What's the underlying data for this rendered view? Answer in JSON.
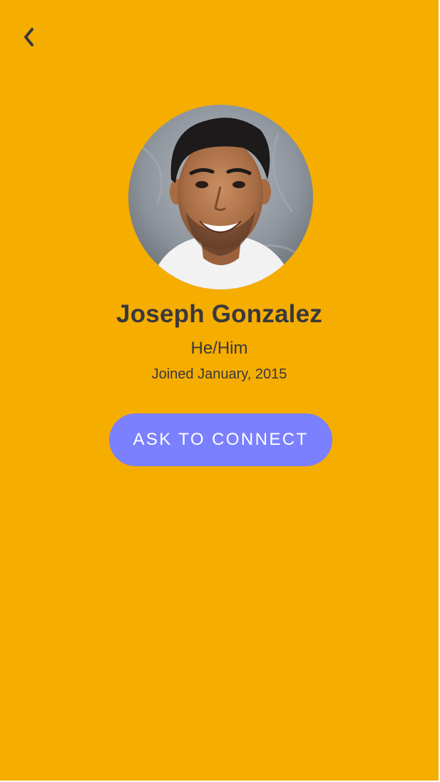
{
  "colors": {
    "background": "#F5AD00",
    "text": "#38383d",
    "button": "#7B80FF",
    "button_text": "#ffffff"
  },
  "nav": {
    "back_icon": "chevron-left-icon"
  },
  "profile": {
    "avatar_icon": "profile-photo",
    "name": "Joseph Gonzalez",
    "pronouns": "He/Him",
    "joined": "Joined January, 2015"
  },
  "actions": {
    "connect_label": "ASK TO CONNECT"
  }
}
